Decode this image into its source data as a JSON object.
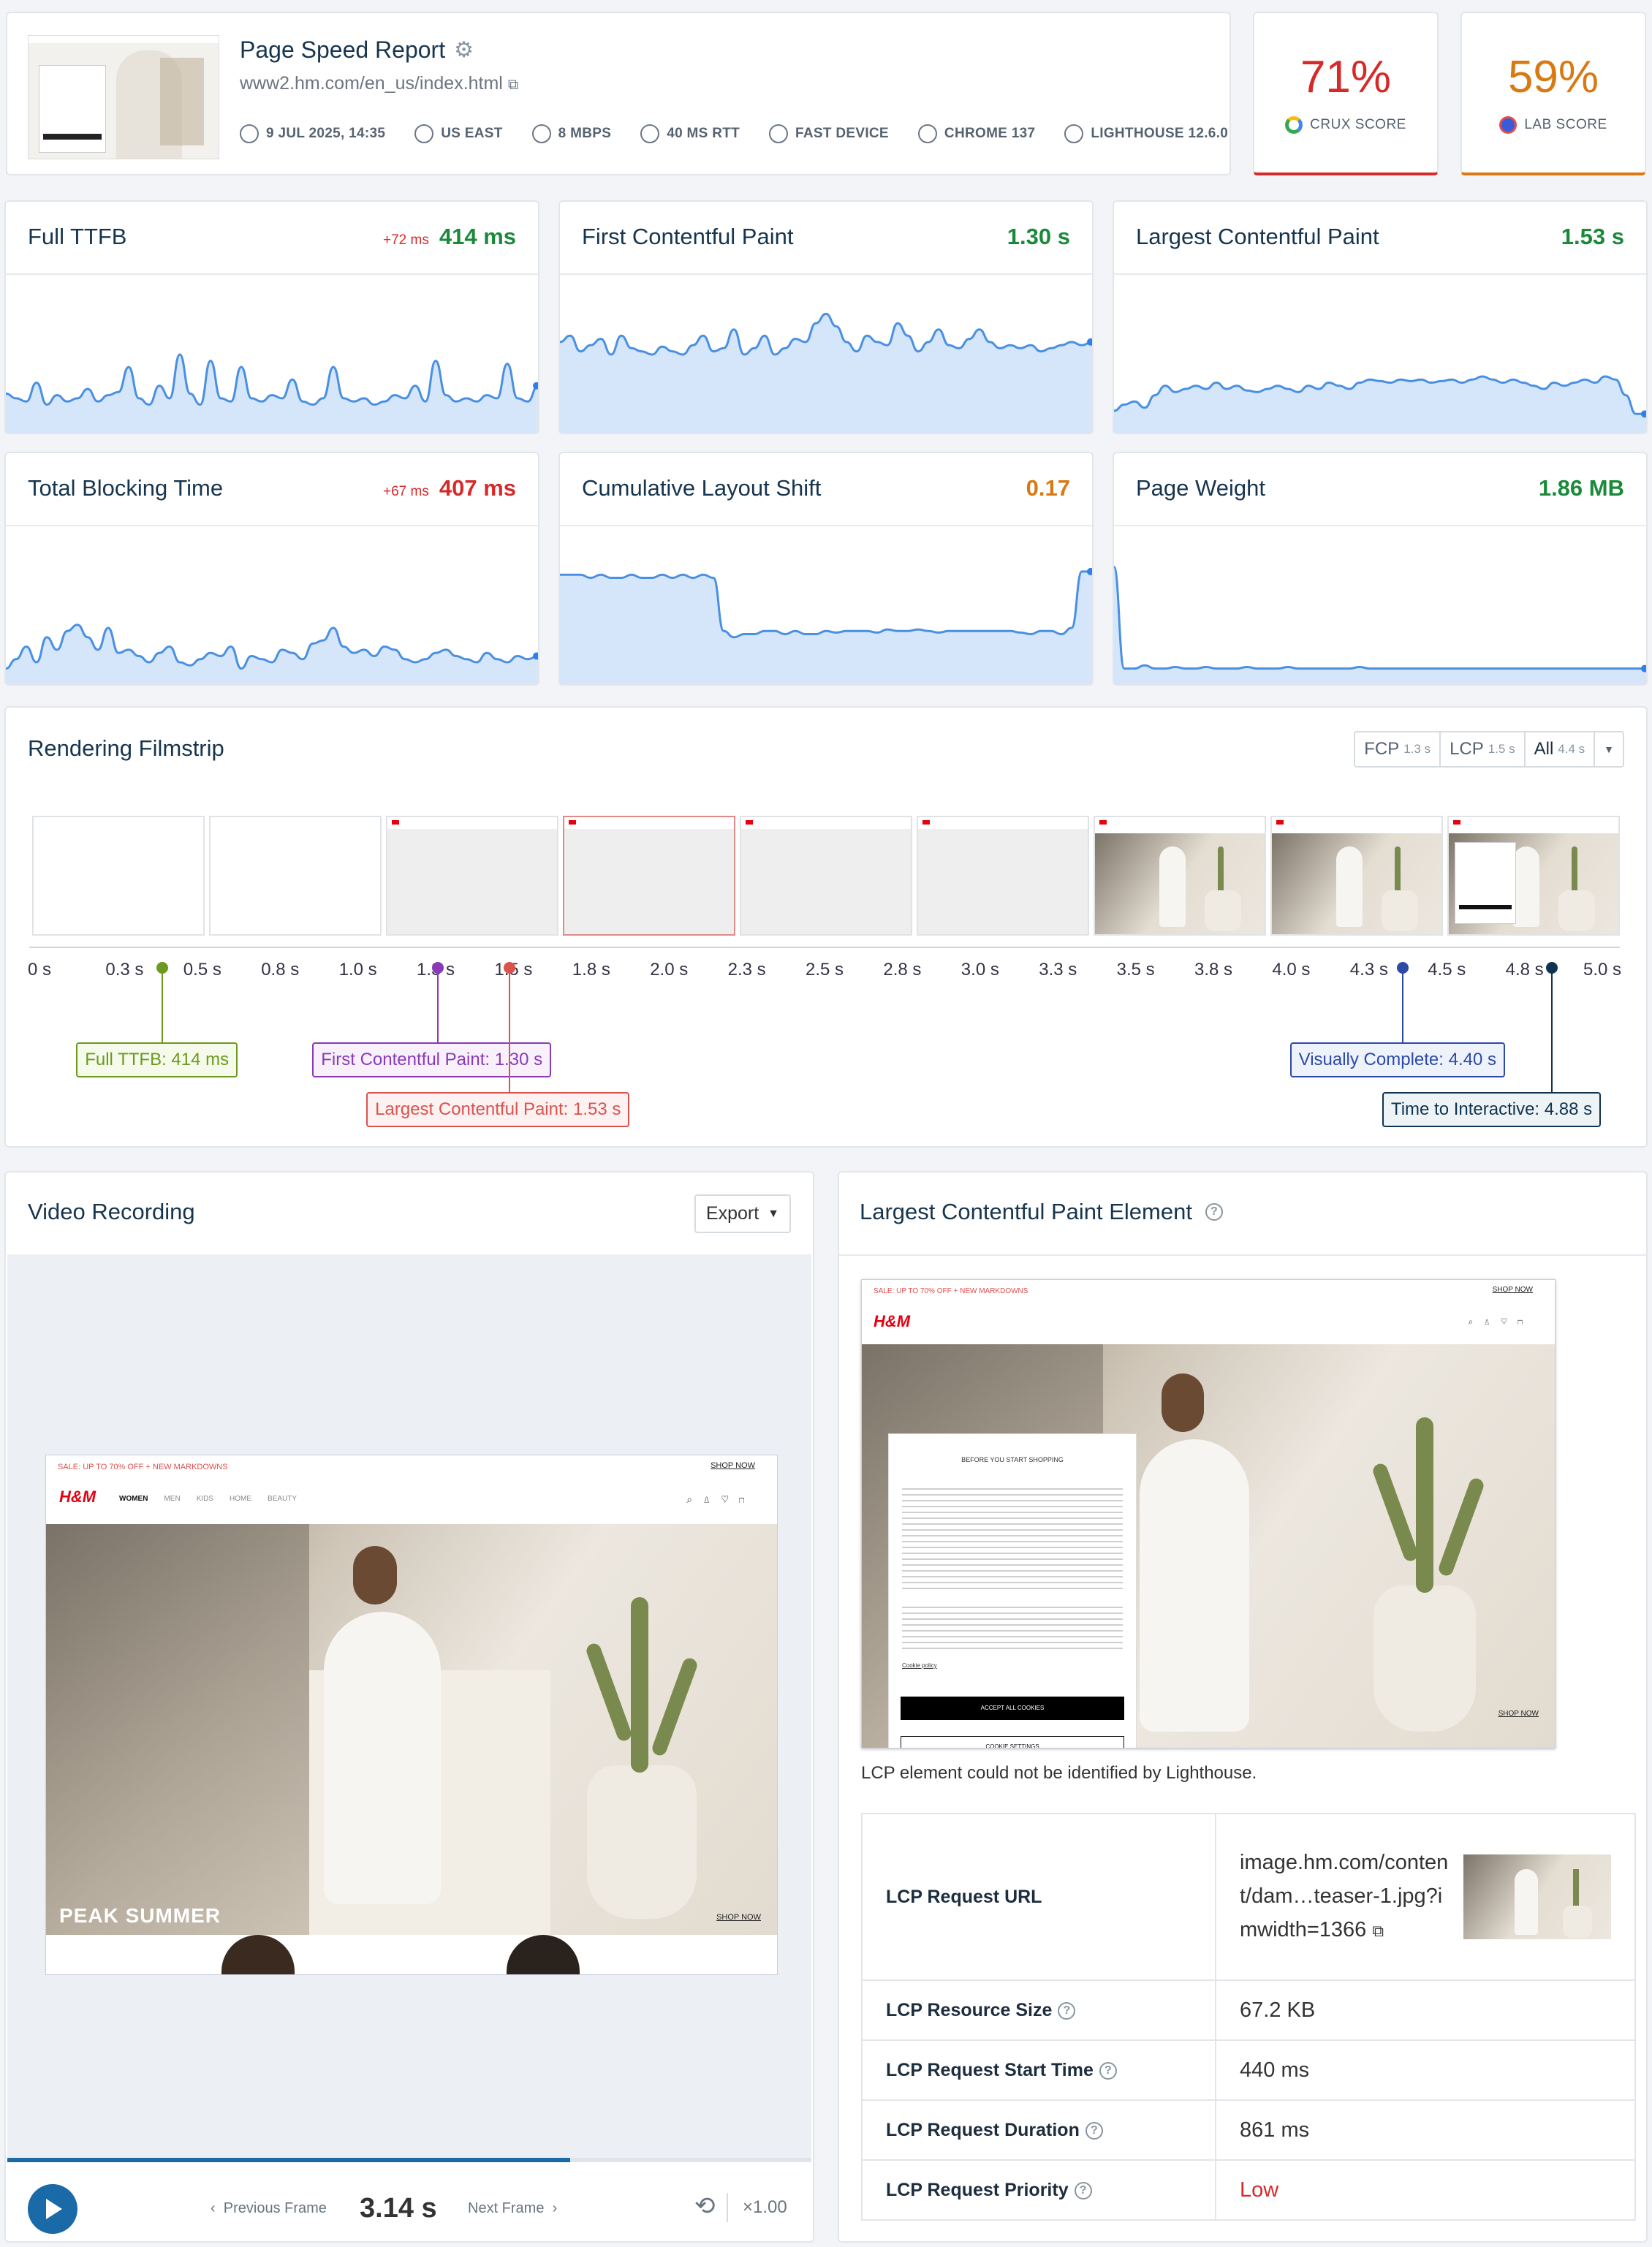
{
  "header": {
    "title": "Page Speed Report",
    "url": "www2.hm.com/en_us/index.html",
    "meta": [
      {
        "icon": "clock-icon",
        "label": "9 JUL 2025, 14:35"
      },
      {
        "icon": "globe-icon",
        "label": "US EAST"
      },
      {
        "icon": "bandwidth-icon",
        "label": "8 MBPS"
      },
      {
        "icon": "latency-icon",
        "label": "40 MS RTT"
      },
      {
        "icon": "device-icon",
        "label": "FAST DEVICE"
      },
      {
        "icon": "chrome-icon",
        "label": "CHROME 137"
      },
      {
        "icon": "lighthouse-icon",
        "label": "LIGHTHOUSE 12.6.0"
      }
    ]
  },
  "scores": {
    "crux": {
      "value": "71%",
      "label": "CRUX SCORE",
      "color": "#d62a2a"
    },
    "lab": {
      "value": "59%",
      "label": "LAB SCORE",
      "color": "#d97914"
    }
  },
  "metrics": [
    {
      "name": "Full TTFB",
      "delta": "+72 ms",
      "value": "414 ms",
      "color": "#1a8a3a",
      "series": [
        0.25,
        0.22,
        0.2,
        0.32,
        0.18,
        0.24,
        0.2,
        0.22,
        0.28,
        0.2,
        0.24,
        0.26,
        0.42,
        0.22,
        0.18,
        0.3,
        0.22,
        0.5,
        0.25,
        0.18,
        0.46,
        0.22,
        0.2,
        0.42,
        0.22,
        0.2,
        0.24,
        0.22,
        0.34,
        0.2,
        0.18,
        0.22,
        0.42,
        0.22,
        0.2,
        0.22,
        0.18,
        0.2,
        0.24,
        0.22,
        0.3,
        0.2,
        0.46,
        0.24,
        0.2,
        0.22,
        0.2,
        0.24,
        0.22,
        0.44,
        0.22,
        0.2,
        0.3
      ]
    },
    {
      "name": "First Contentful Paint",
      "delta": "",
      "value": "1.30 s",
      "color": "#1a8a3a",
      "series": [
        0.58,
        0.62,
        0.52,
        0.56,
        0.6,
        0.5,
        0.62,
        0.54,
        0.52,
        0.5,
        0.55,
        0.52,
        0.5,
        0.56,
        0.62,
        0.52,
        0.54,
        0.66,
        0.5,
        0.54,
        0.62,
        0.5,
        0.54,
        0.6,
        0.58,
        0.7,
        0.76,
        0.68,
        0.58,
        0.52,
        0.62,
        0.58,
        0.56,
        0.7,
        0.62,
        0.52,
        0.58,
        0.66,
        0.56,
        0.54,
        0.6,
        0.66,
        0.58,
        0.54,
        0.56,
        0.54,
        0.56,
        0.52,
        0.54,
        0.56,
        0.58,
        0.56,
        0.58
      ]
    },
    {
      "name": "Largest Contentful Paint",
      "delta": "",
      "value": "1.53 s",
      "color": "#1a8a3a",
      "series": [
        0.14,
        0.18,
        0.2,
        0.16,
        0.24,
        0.3,
        0.26,
        0.28,
        0.3,
        0.28,
        0.32,
        0.28,
        0.3,
        0.27,
        0.26,
        0.28,
        0.3,
        0.28,
        0.26,
        0.3,
        0.28,
        0.32,
        0.3,
        0.28,
        0.32,
        0.34,
        0.33,
        0.32,
        0.34,
        0.33,
        0.34,
        0.32,
        0.33,
        0.34,
        0.32,
        0.34,
        0.36,
        0.34,
        0.32,
        0.34,
        0.32,
        0.3,
        0.28,
        0.32,
        0.3,
        0.32,
        0.34,
        0.32,
        0.36,
        0.34,
        0.24,
        0.12,
        0.12
      ]
    },
    {
      "name": "Total Blocking Time",
      "delta": "+67 ms",
      "value": "407 ms",
      "color": "#d62a2a",
      "series": [
        0.1,
        0.16,
        0.24,
        0.14,
        0.3,
        0.22,
        0.34,
        0.38,
        0.3,
        0.22,
        0.36,
        0.2,
        0.22,
        0.18,
        0.14,
        0.2,
        0.24,
        0.14,
        0.12,
        0.16,
        0.2,
        0.18,
        0.24,
        0.1,
        0.18,
        0.16,
        0.14,
        0.22,
        0.2,
        0.16,
        0.26,
        0.28,
        0.36,
        0.24,
        0.2,
        0.22,
        0.18,
        0.24,
        0.22,
        0.16,
        0.14,
        0.16,
        0.2,
        0.22,
        0.18,
        0.16,
        0.14,
        0.2,
        0.16,
        0.14,
        0.18,
        0.16,
        0.18
      ]
    },
    {
      "name": "Cumulative Layout Shift",
      "delta": "",
      "value": "0.17",
      "color": "#d97914",
      "series": [
        0.7,
        0.7,
        0.7,
        0.68,
        0.7,
        0.68,
        0.68,
        0.7,
        0.68,
        0.68,
        0.7,
        0.68,
        0.7,
        0.68,
        0.7,
        0.68,
        0.34,
        0.3,
        0.32,
        0.32,
        0.34,
        0.34,
        0.32,
        0.34,
        0.32,
        0.32,
        0.34,
        0.33,
        0.34,
        0.34,
        0.34,
        0.33,
        0.35,
        0.34,
        0.34,
        0.35,
        0.34,
        0.33,
        0.34,
        0.34,
        0.34,
        0.34,
        0.34,
        0.34,
        0.34,
        0.33,
        0.32,
        0.34,
        0.34,
        0.32,
        0.36,
        0.72,
        0.72
      ]
    },
    {
      "name": "Page Weight",
      "delta": "",
      "value": "1.86 MB",
      "color": "#1a8a3a",
      "series": [
        0.75,
        0.1,
        0.1,
        0.12,
        0.1,
        0.1,
        0.11,
        0.1,
        0.1,
        0.11,
        0.1,
        0.1,
        0.1,
        0.11,
        0.1,
        0.1,
        0.1,
        0.11,
        0.1,
        0.1,
        0.1,
        0.1,
        0.1,
        0.1,
        0.11,
        0.1,
        0.1,
        0.1,
        0.1,
        0.1,
        0.1,
        0.1,
        0.1,
        0.1,
        0.1,
        0.1,
        0.1,
        0.1,
        0.1,
        0.1,
        0.1,
        0.1,
        0.1,
        0.1,
        0.1,
        0.1,
        0.1,
        0.1,
        0.1,
        0.1,
        0.1,
        0.1,
        0.1
      ]
    }
  ],
  "filmstrip": {
    "title": "Rendering Filmstrip",
    "toggle": [
      {
        "label": "FCP",
        "sub": "1.3 s"
      },
      {
        "label": "LCP",
        "sub": "1.5 s"
      },
      {
        "label": "All",
        "sub": "4.4 s"
      }
    ],
    "ticks": [
      "0 s",
      "0.3 s",
      "0.5 s",
      "0.8 s",
      "1.0 s",
      "1.3 s",
      "1.5 s",
      "1.8 s",
      "2.0 s",
      "2.3 s",
      "2.5 s",
      "2.8 s",
      "3.0 s",
      "3.3 s",
      "3.5 s",
      "3.8 s",
      "4.0 s",
      "4.3 s",
      "4.5 s",
      "4.8 s",
      "5.0 s"
    ],
    "markers": [
      {
        "label": "Full TTFB: 414 ms",
        "time": 0.414,
        "color": "#6b9a1e",
        "bg": "#f5faea"
      },
      {
        "label": "First Contentful Paint: 1.30 s",
        "time": 1.3,
        "color": "#8a3ab8",
        "bg": "#f8f1fc"
      },
      {
        "label": "Largest Contentful Paint: 1.53 s",
        "time": 1.53,
        "color": "#d9534f",
        "bg": "#fdf1f1"
      },
      {
        "label": "Visually Complete: 4.40 s",
        "time": 4.4,
        "color": "#2d4aa8",
        "bg": "#eef2fb"
      },
      {
        "label": "Time to Interactive: 4.88 s",
        "time": 4.88,
        "color": "#10344f",
        "bg": "#eef3f6"
      }
    ],
    "frame_kinds": [
      "blank",
      "blank",
      "grey",
      "grey",
      "grey",
      "grey",
      "photo",
      "photo",
      "popup"
    ]
  },
  "video": {
    "title": "Video Recording",
    "export_label": "Export",
    "prev_label": "Previous Frame",
    "time": "3.14 s",
    "next_label": "Next Frame",
    "speed": "×1.00",
    "progress": 0.7,
    "banner": "SALE: UP TO 70% OFF + NEW MARKDOWNS",
    "shop_now": "SHOP NOW",
    "brand": "H&M",
    "nav": [
      "WOMEN",
      "MEN",
      "KIDS",
      "HOME",
      "BEAUTY"
    ],
    "hero_text": "PEAK SUMMER"
  },
  "lcp": {
    "title": "Largest Contentful Paint Element",
    "note": "LCP element could not be identified by Lighthouse.",
    "popup_title": "BEFORE YOU START SHOPPING",
    "popup_accept": "ACCEPT ALL COOKIES",
    "popup_settings": "COOKIE SETTINGS",
    "popup_link": "Cookie policy",
    "rows": [
      {
        "key": "LCP Request URL",
        "value": "image.hm.com/content/dam…teaser-1.jpg?imwidth=1366",
        "help": false
      },
      {
        "key": "LCP Resource Size",
        "value": "67.2 KB",
        "help": true
      },
      {
        "key": "LCP Request Start Time",
        "value": "440 ms",
        "help": true
      },
      {
        "key": "LCP Request Duration",
        "value": "861 ms",
        "help": true
      },
      {
        "key": "LCP Request Priority",
        "value": "Low",
        "help": true
      }
    ]
  }
}
